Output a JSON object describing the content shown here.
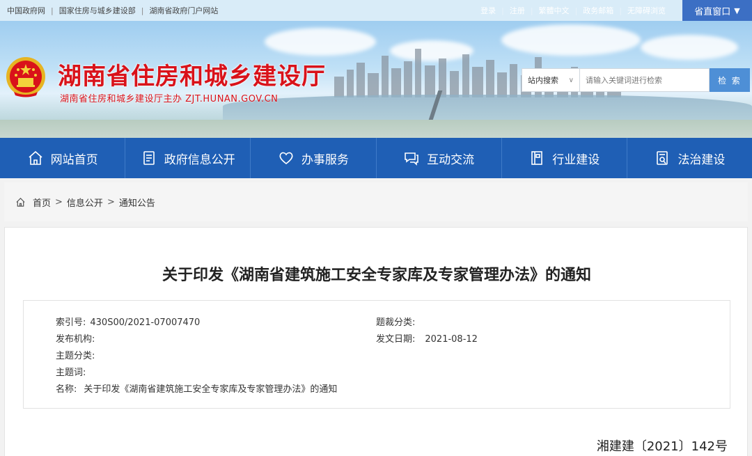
{
  "topbar": {
    "left_links": [
      "中国政府网",
      "国家住房与城乡建设部",
      "湖南省政府门户网站"
    ],
    "right_links": [
      "登录",
      "注册",
      "繁體中文",
      "政务邮箱",
      "无障碍浏览"
    ],
    "province_window": "省直窗口",
    "province_window_icon": "caret-down-icon"
  },
  "banner": {
    "title": "湖南省住房和城乡建设厅",
    "subtitle": "湖南省住房和城乡建设厅主办  ZJT.HUNAN.GOV.CN"
  },
  "search": {
    "scope": "站内搜索",
    "placeholder": "请输入关键词进行检索",
    "button": "检 索"
  },
  "nav": {
    "items": [
      {
        "label": "网站首页",
        "icon": "home-icon"
      },
      {
        "label": "政府信息公开",
        "icon": "document-icon"
      },
      {
        "label": "办事服务",
        "icon": "heart-icon"
      },
      {
        "label": "互动交流",
        "icon": "chat-icon"
      },
      {
        "label": "行业建设",
        "icon": "building-icon"
      },
      {
        "label": "法治建设",
        "icon": "law-icon"
      }
    ]
  },
  "breadcrumb": {
    "items": [
      "首页",
      "信息公开",
      "通知公告"
    ],
    "separator": ">"
  },
  "article": {
    "title": "关于印发《湖南省建筑施工安全专家库及专家管理办法》的通知",
    "meta": {
      "index_label": "索引号:",
      "index_value": "430S00/2021-07007470",
      "genre_label": "题裁分类:",
      "genre_value": "",
      "publisher_label": "发布机构:",
      "publisher_value": "",
      "date_label": "发文日期:",
      "date_value": "2021-08-12",
      "category_label": "主题分类:",
      "category_value": "",
      "keywords_label": "主题词:",
      "keywords_value": "",
      "name_label": "名称:",
      "name_value": "关于印发《湖南省建筑施工安全专家库及专家管理办法》的通知"
    },
    "doc_number": "湘建建〔2021〕142号"
  },
  "colors": {
    "nav_bg": "#1f5fb5",
    "title_red": "#d9121a",
    "search_button": "#4e8fd6",
    "province_window_bg": "#3c6fc4"
  }
}
